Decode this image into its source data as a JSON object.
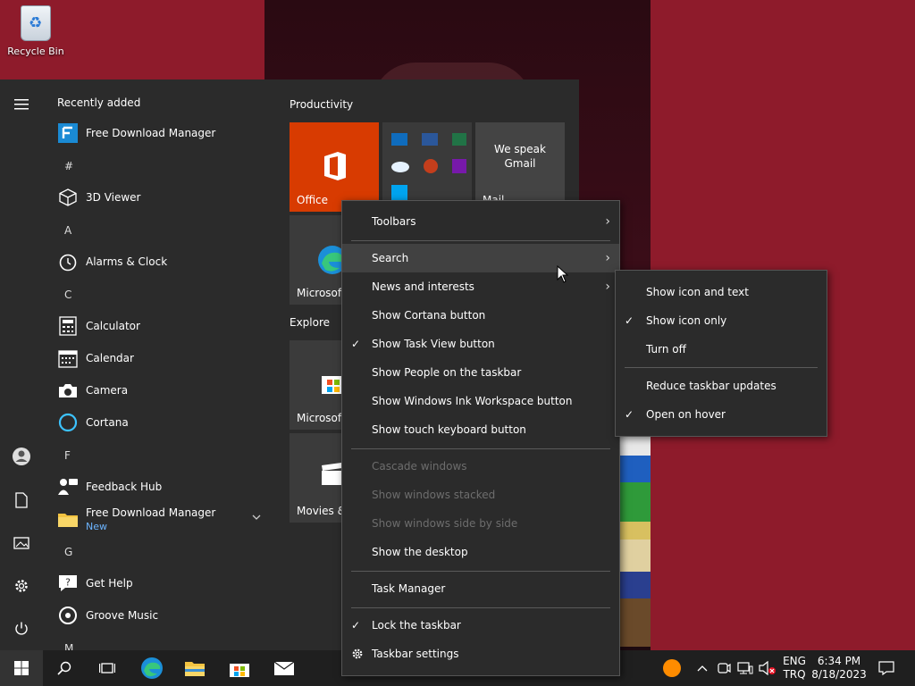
{
  "desktop": {
    "recycle_bin_label": "Recycle Bin"
  },
  "start_menu": {
    "recently_added_title": "Recently added",
    "apps": [
      {
        "label": "Free Download Manager",
        "icon": "fdm-icon"
      },
      {
        "label": "#",
        "is_letter": true
      },
      {
        "label": "3D Viewer",
        "icon": "cube-icon"
      },
      {
        "label": "A",
        "is_letter": true
      },
      {
        "label": "Alarms & Clock",
        "icon": "clock-icon"
      },
      {
        "label": "C",
        "is_letter": true
      },
      {
        "label": "Calculator",
        "icon": "calculator-icon"
      },
      {
        "label": "Calendar",
        "icon": "calendar-icon"
      },
      {
        "label": "Camera",
        "icon": "camera-icon"
      },
      {
        "label": "Cortana",
        "icon": "cortana-icon"
      },
      {
        "label": "F",
        "is_letter": true
      },
      {
        "label": "Feedback Hub",
        "icon": "feedback-icon"
      },
      {
        "label": "Free Download Manager",
        "sublabel": "New",
        "icon": "folder-icon"
      },
      {
        "label": "G",
        "is_letter": true
      },
      {
        "label": "Get Help",
        "icon": "help-icon"
      },
      {
        "label": "Groove Music",
        "icon": "music-icon"
      },
      {
        "label": "M",
        "is_letter": true
      }
    ],
    "groups": {
      "productivity": "Productivity",
      "explore": "Explore"
    },
    "tiles": {
      "office": "Office",
      "gmail": "We speak Gmail",
      "mail_partial": "Mail",
      "edge_partial": "Microsoft",
      "store_partial": "Microsoft",
      "movies_partial": "Movies &"
    }
  },
  "context_menu": {
    "items": [
      {
        "label": "Toolbars",
        "arrow": true
      },
      {
        "label": "Search",
        "arrow": true,
        "hover": true
      },
      {
        "label": "News and interests",
        "arrow": true
      },
      {
        "label": "Show Cortana button"
      },
      {
        "label": "Show Task View button",
        "checked": true
      },
      {
        "label": "Show People on the taskbar"
      },
      {
        "label": "Show Windows Ink Workspace button"
      },
      {
        "label": "Show touch keyboard button"
      },
      {
        "label": "Cascade windows",
        "disabled": true
      },
      {
        "label": "Show windows stacked",
        "disabled": true
      },
      {
        "label": "Show windows side by side",
        "disabled": true
      },
      {
        "label": "Show the desktop"
      },
      {
        "label": "Task Manager"
      },
      {
        "label": "Lock the taskbar",
        "checked": true
      },
      {
        "label": "Taskbar settings",
        "gear": true
      }
    ]
  },
  "submenu": {
    "items": [
      {
        "label": "Show icon and text"
      },
      {
        "label": "Show icon only",
        "checked": true
      },
      {
        "label": "Turn off"
      },
      {
        "label": "Reduce taskbar updates"
      },
      {
        "label": "Open on hover",
        "checked": true
      }
    ]
  },
  "taskbar": {
    "language_line1": "ENG",
    "language_line2": "TRQ",
    "time": "6:34 PM",
    "date": "8/18/2023"
  },
  "colors": {
    "accent_office": "#d83b01",
    "desktop_bg": "#8e1b2b",
    "menu_bg": "#2b2b2b",
    "taskbar_bg": "#1f1f1f"
  }
}
